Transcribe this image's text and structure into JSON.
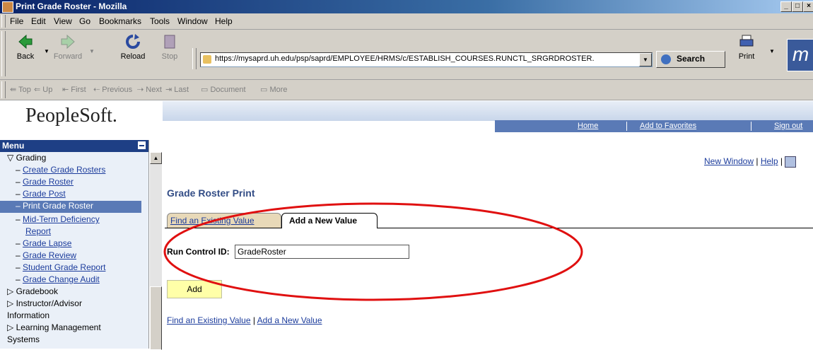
{
  "window": {
    "title": "Print Grade Roster - Mozilla",
    "controls": [
      "_",
      "□",
      "×"
    ]
  },
  "menubar": {
    "items": [
      "File",
      "Edit",
      "View",
      "Go",
      "Bookmarks",
      "Tools",
      "Window",
      "Help"
    ]
  },
  "navbar": {
    "back": "Back",
    "forward": "Forward",
    "reload": "Reload",
    "stop": "Stop",
    "url": "https://mysaprd.uh.edu/psp/saprd/EMPLOYEE/HRMS/c/ESTABLISH_COURSES.RUNCTL_SRGRDROSTER.",
    "search": "Search",
    "print": "Print"
  },
  "personal_toolbar": {
    "items": [
      "Top",
      "Up",
      "First",
      "Previous",
      "Next",
      "Last",
      "Document",
      "More"
    ]
  },
  "banner": {
    "logo": "PeopleSoft.",
    "links": [
      "Home",
      "Add to Favorites",
      "Sign out"
    ]
  },
  "menu": {
    "title": "Menu",
    "section": "Grading",
    "items": [
      "Create Grade Rosters",
      "Grade Roster",
      "Grade Post",
      "Print Grade Roster",
      "Mid-Term Deficiency",
      "Report",
      "Grade Lapse",
      "Grade Review",
      "Student Grade Report",
      "Grade Change Audit"
    ],
    "folders": [
      "Gradebook",
      "Instructor/Advisor",
      "Information",
      "Learning Management",
      "Systems"
    ]
  },
  "content": {
    "top_links": [
      "New Window",
      "Help"
    ],
    "page_title": "Grade Roster Print",
    "tabs": [
      "Find an Existing Value",
      "Add a New Value"
    ],
    "run_control_label": "Run Control ID:",
    "run_control_value": "GradeRoster",
    "add_button": "Add",
    "bottom_links": [
      "Find an Existing Value",
      "Add a New Value"
    ]
  },
  "colors": {
    "annotation_oval": "#e01010",
    "menu_selected": "#5a7ab6",
    "menu_header": "#1e3f85",
    "link": "#1c3c9c",
    "add_button": "#ffffa8"
  }
}
